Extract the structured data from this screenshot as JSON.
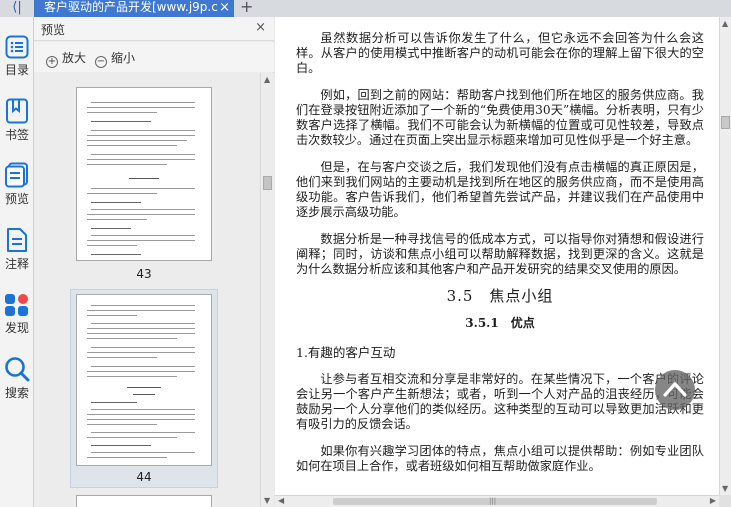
{
  "tabbar": {
    "back_glyph": "⟨|",
    "tab_title": "客户驱动的产品开发[www.j9p.c",
    "close_glyph": "×",
    "add_glyph": "+"
  },
  "toolbar": {
    "items": [
      {
        "label": "目录",
        "icon": "list-icon"
      },
      {
        "label": "书签",
        "icon": "bookmark-icon"
      },
      {
        "label": "预览",
        "icon": "preview-icon"
      },
      {
        "label": "注释",
        "icon": "note-icon"
      },
      {
        "label": "发现",
        "icon": "discover-icon"
      },
      {
        "label": "搜索",
        "icon": "search-icon"
      }
    ],
    "accent": "#1a73d6"
  },
  "preview": {
    "title": "预览",
    "close_glyph": "×",
    "zoom_in": "放大",
    "zoom_out": "缩小",
    "pages": [
      {
        "number": "43",
        "selected": false
      },
      {
        "number": "44",
        "selected": true
      }
    ]
  },
  "document": {
    "para1": "虽然数据分析可以告诉你发生了什么，但它永远不会回答为什么会这样。从客户的使用模式中推断客户的动机可能会在你的理解上留下很大的空白。",
    "para2": "例如，回到之前的网站：帮助客户找到他们所在地区的服务供应商。我们在登录按钮附近添加了一个新的“免费使用30天”横幅。分析表明，只有少数客户选择了横幅。我们不可能会认为新横幅的位置或可见性较差，导致点击次数较少。通过在页面上突出显示标题来增加可见性似乎是一个好主意。",
    "para3": "但是，在与客户交谈之后，我们发现他们没有点击横幅的真正原因是，他们来到我们网站的主要动机是找到所在地区的服务供应商，而不是使用高级功能。客户告诉我们，他们希望首先尝试产品，并建议我们在产品使用中逐步展示高级功能。",
    "para4": "数据分析是一种寻找信号的低成本方式，可以指导你对猜想和假设进行阐释；同时，访谈和焦点小组可以帮助解释数据，找到更深的含义。这就是为什么数据分析应该和其他客户和产品开发研究的结果交叉使用的原因。",
    "section_title": "3.5　焦点小组",
    "subsection_title": "3.5.1　优点",
    "item_title": "1.有趣的客户互动",
    "para5": "让参与者互相交流和分享是非常好的。在某些情况下，一个客户的评论会让另一个客户产生新想法；或者，听到一个人对产品的沮丧经历，可能会鼓励另一个人分享他们的类似经历。这种类型的互动可以导致更加活跃和更有吸引力的反馈会话。",
    "para6": "如果你有兴趣学习团体的特点，焦点小组可以提供帮助：例如专业团队如何在项目上合作，或者班级如何相互帮助做家庭作业。"
  }
}
